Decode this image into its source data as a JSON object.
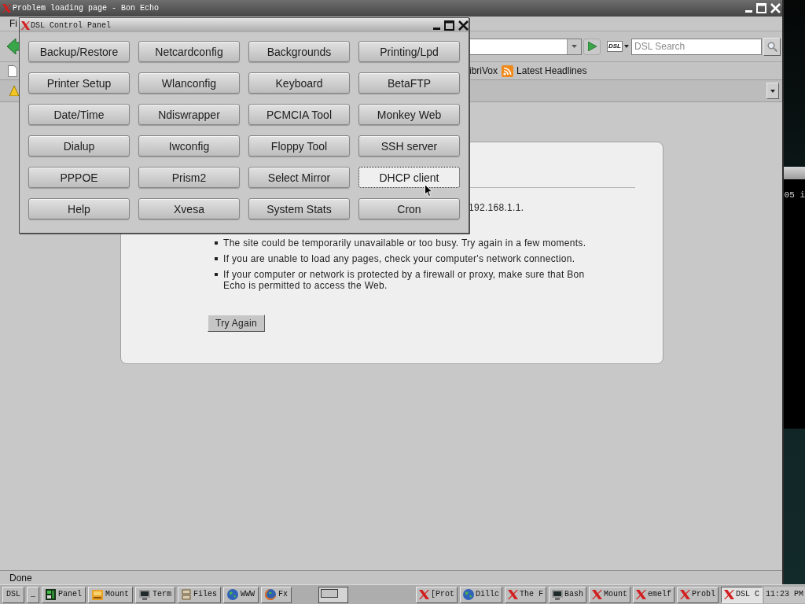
{
  "browser_window": {
    "title": "Problem loading page - Bon Echo",
    "menu_items": [
      "Fi"
    ],
    "search_engine_label": "DSL",
    "search": {
      "placeholder": "DSL Search"
    },
    "bookmarks": [
      {
        "label": "ibriVox",
        "kind": "plain"
      },
      {
        "label": "Latest Headlines",
        "kind": "feed"
      }
    ],
    "status_text": "Done"
  },
  "error_page": {
    "address_fragment": "192.168.1.1.",
    "suggestions": [
      "The site could be temporarily unavailable or too busy. Try again in a few moments.",
      "If you are unable to load any pages, check your computer's network connection.",
      "If your computer or network is protected by a firewall or proxy, make sure that Bon Echo is permitted to access the Web."
    ],
    "try_again_button": "Try Again"
  },
  "control_panel": {
    "title": "DSL Control Panel",
    "buttons": [
      {
        "label": "Backup/Restore",
        "focused": false
      },
      {
        "label": "Netcardconfig",
        "focused": false
      },
      {
        "label": "Backgrounds",
        "focused": false
      },
      {
        "label": "Printing/Lpd",
        "focused": false
      },
      {
        "label": "Printer Setup",
        "focused": false
      },
      {
        "label": "Wlanconfig",
        "focused": false
      },
      {
        "label": "Keyboard",
        "focused": false
      },
      {
        "label": "BetaFTP",
        "focused": false
      },
      {
        "label": "Date/Time",
        "focused": false
      },
      {
        "label": "Ndiswrapper",
        "focused": false
      },
      {
        "label": "PCMCIA Tool",
        "focused": false
      },
      {
        "label": "Monkey Web",
        "focused": false
      },
      {
        "label": "Dialup",
        "focused": false
      },
      {
        "label": "Iwconfig",
        "focused": false
      },
      {
        "label": "Floppy Tool",
        "focused": false
      },
      {
        "label": "SSH server",
        "focused": false
      },
      {
        "label": "PPPOE",
        "focused": false
      },
      {
        "label": "Prism2",
        "focused": false
      },
      {
        "label": "Select Mirror",
        "focused": false
      },
      {
        "label": "DHCP client",
        "focused": true
      },
      {
        "label": "Help",
        "focused": false
      },
      {
        "label": "Xvesa",
        "focused": false
      },
      {
        "label": "System Stats",
        "focused": false
      },
      {
        "label": "Cron",
        "focused": false
      }
    ]
  },
  "desktop": {
    "terminal_text": "05 i"
  },
  "taskbar": {
    "launchers": [
      {
        "label": "DSL",
        "kind": "plain"
      },
      {
        "label": "_",
        "kind": "plain"
      },
      {
        "label": "Panel",
        "kind": "board"
      },
      {
        "label": "Mount",
        "kind": "drive"
      },
      {
        "label": "Term",
        "kind": "monitor"
      },
      {
        "label": "Files",
        "kind": "cabinet"
      },
      {
        "label": "WWW",
        "kind": "globe"
      },
      {
        "label": "Fx",
        "kind": "fox"
      }
    ],
    "tasks": [
      {
        "label": "[Prot",
        "kind": "xapp",
        "selected": false
      },
      {
        "label": "Dillc",
        "kind": "globe",
        "selected": false
      },
      {
        "label": "The F",
        "kind": "xapp",
        "selected": false
      },
      {
        "label": "Bash",
        "kind": "monitor",
        "selected": false
      },
      {
        "label": "Mount",
        "kind": "xapp",
        "selected": false
      },
      {
        "label": "emelf",
        "kind": "xapp",
        "selected": false
      },
      {
        "label": "Probl",
        "kind": "xapp",
        "selected": false
      },
      {
        "label": "DSL C",
        "kind": "xapp",
        "selected": true
      }
    ],
    "clock": "11:23 PM"
  }
}
